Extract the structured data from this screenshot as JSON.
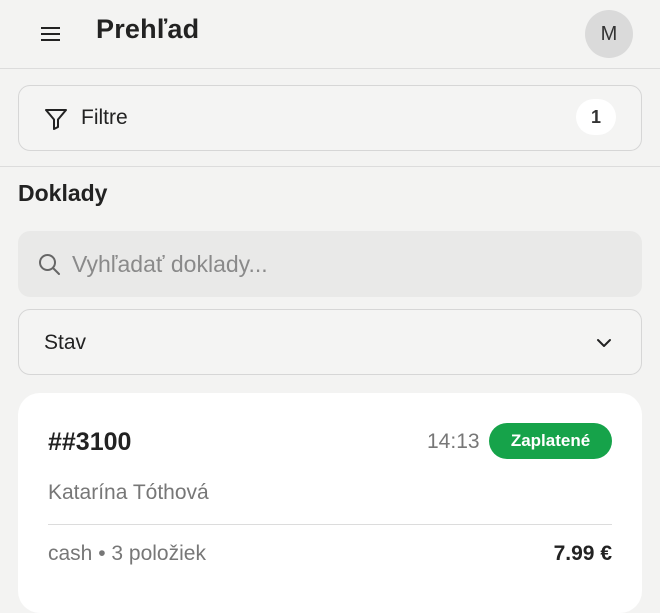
{
  "header": {
    "title": "Prehľad",
    "avatar_initial": "M"
  },
  "filters": {
    "label": "Filtre",
    "count": "1"
  },
  "documents": {
    "section_title": "Doklady",
    "search_placeholder": "Vyhľadať doklady...",
    "status_label": "Stav"
  },
  "cards": [
    {
      "id": "##3100",
      "time": "14:13",
      "status": "Zaplatené",
      "customer": "Katarína Tóthová",
      "meta": "cash • 3 položiek",
      "total": "7.99 €"
    }
  ],
  "colors": {
    "background": "#f3f3f2",
    "paid_badge": "#16a34a",
    "card": "#ffffff"
  },
  "icons": {
    "menu": "menu-icon",
    "filter": "filter-icon",
    "search": "search-icon",
    "chevron": "chevron-down-icon"
  }
}
